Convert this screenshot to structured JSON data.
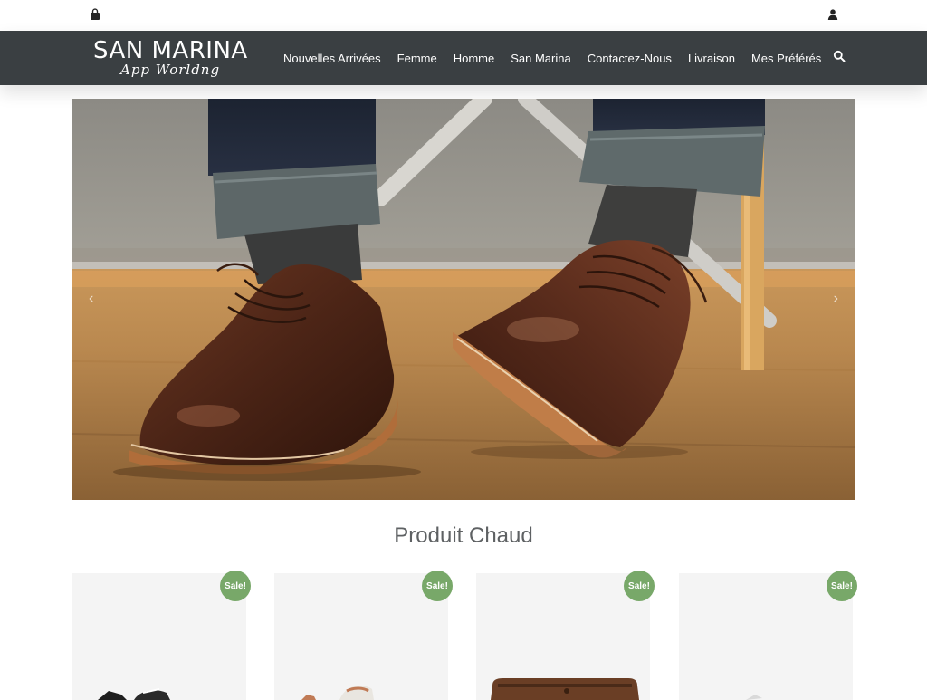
{
  "topbar": {
    "cart_icon": "shopping-bag-icon",
    "account_icon": "user-icon"
  },
  "header": {
    "brand_name": "SAN MARINA",
    "brand_tagline": "App Worldng",
    "nav": [
      "Nouvelles Arrivées",
      "Femme",
      "Homme",
      "San Marina",
      "Contactez-Nous",
      "Livraison",
      "Mes Préférés"
    ],
    "search_icon": "search-icon"
  },
  "hero": {
    "prev_label": "‹",
    "next_label": "›"
  },
  "section": {
    "title": "Produit Chaud"
  },
  "products": [
    {
      "badge": "Sale!"
    },
    {
      "badge": "Sale!"
    },
    {
      "badge": "Sale!"
    },
    {
      "badge": "Sale!"
    }
  ],
  "colors": {
    "navbar": "#3a3f42",
    "sale_badge": "#78a869",
    "card_bg": "#f4f4f4"
  }
}
